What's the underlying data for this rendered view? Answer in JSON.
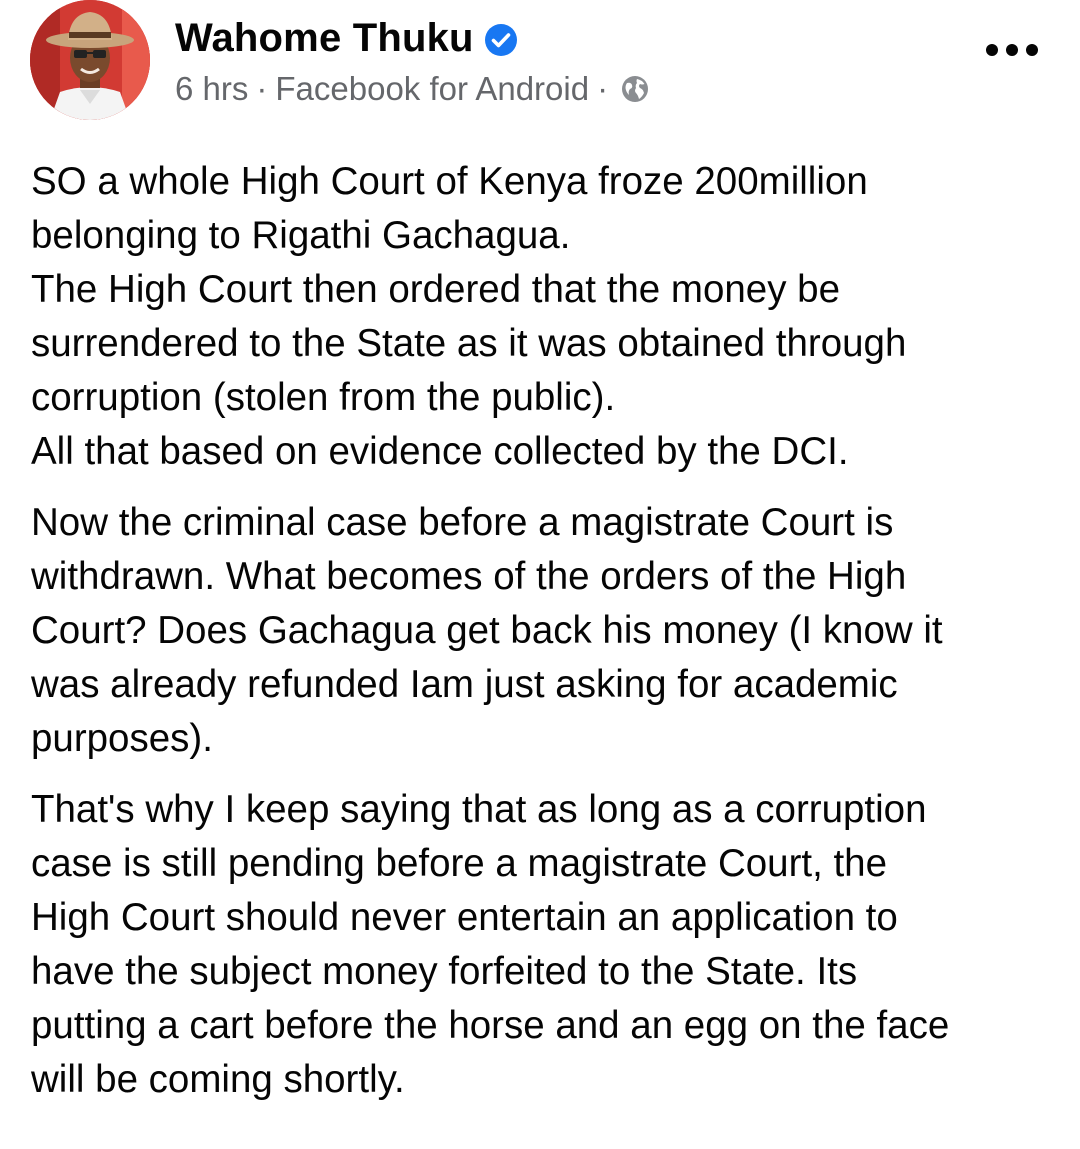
{
  "author": {
    "name": "Wahome Thuku",
    "verified": true,
    "avatar": "avatar-photo"
  },
  "meta": {
    "time": "6 hrs",
    "separator": "·",
    "source": "Facebook for Android",
    "audience_icon": "globe-icon"
  },
  "actions": {
    "more_icon": "more-options-icon"
  },
  "colors": {
    "verified_badge": "#1877f2",
    "meta_text": "#65676b",
    "body_text": "#050505"
  },
  "post": {
    "paragraphs": [
      "SO a whole High Court of Kenya froze 200million\nbelonging to Rigathi Gachagua.\nThe High Court then ordered that the money be\nsurrendered to the State as it was obtained through\ncorruption (stolen from the public).\nAll that based on evidence collected by the DCI.",
      "Now the criminal case before a magistrate Court is\nwithdrawn. What becomes of the orders of the High\nCourt? Does Gachagua get back his money (I know it\nwas already refunded Iam just asking for academic\npurposes).",
      "That's why I keep saying that as long as a corruption\ncase is still pending before a magistrate Court, the\nHigh Court should never entertain an application to\nhave the subject money forfeited to the State. Its\nputting a cart before the horse and an egg on the face\nwill be coming shortly."
    ]
  }
}
